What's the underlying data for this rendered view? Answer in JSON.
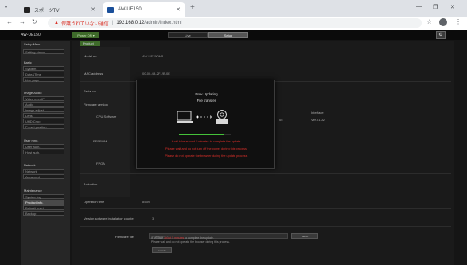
{
  "browser": {
    "tabs": [
      {
        "label": "スポーツTV",
        "active": false
      },
      {
        "label": "AW-UE150",
        "active": true
      }
    ],
    "insecure_label": "保護されていない通信",
    "url_host": "192.168.0.12",
    "url_path": "/admin/index.html"
  },
  "app": {
    "model": "AW-UE150",
    "power_label": "Power ON ▾",
    "view_tabs": {
      "live": "Live",
      "setup": "Setup"
    }
  },
  "sidebar": {
    "groups": [
      {
        "head": "Setup Menu",
        "items": [
          {
            "label": "Setting status"
          }
        ]
      },
      {
        "head": "Basic",
        "items": [
          {
            "label": "System"
          },
          {
            "label": "Date&Time"
          },
          {
            "label": "Live page"
          }
        ]
      },
      {
        "head": "Image/Audio",
        "items": [
          {
            "label": "Video over IP"
          },
          {
            "label": "Audio"
          },
          {
            "label": "Image adjust"
          },
          {
            "label": "Lens"
          },
          {
            "label": "UHD Crop"
          },
          {
            "label": "Preset position"
          }
        ]
      },
      {
        "head": "User mng.",
        "items": [
          {
            "label": "User auth."
          },
          {
            "label": "Host auth."
          }
        ]
      },
      {
        "head": "Network",
        "items": [
          {
            "label": "Network"
          },
          {
            "label": "Advanced"
          }
        ]
      },
      {
        "head": "Maintenance",
        "items": [
          {
            "label": "System log"
          },
          {
            "label": "Product info."
          },
          {
            "label": "Default reset"
          },
          {
            "label": "Backup"
          }
        ]
      }
    ]
  },
  "main": {
    "title": "Product info.",
    "rows": {
      "model_label": "Model no.",
      "model_value": "AW-UE150WP",
      "mac_label": "MAC address",
      "mac_value": "00-00-4B-2F-2B-0E",
      "serial_label": "Serial no.",
      "firmware_label": "Firmware version",
      "cpu_label": "CPU Software",
      "eeprom_label": "EEPROM",
      "fpga_label": "FPGA",
      "activation_label": "Activation",
      "optime_label": "Operation time",
      "optime_value": "855h",
      "install_label": "Version software installation counter",
      "install_value": "3"
    },
    "version_headers": {
      "interface": "Interface"
    },
    "version_values": {
      "cpu_tail": "05",
      "cpu_interface": "Ver.01.02"
    },
    "firmware_file_label": "Firmware file",
    "firmware_input_placeholder": "C:\\fakepath\\...\\...",
    "select_button": "Select",
    "execute_button": "Execute",
    "note_line1_pre": "It will take",
    "note_line1_red": "about 5 minutes",
    "note_line1_post": "to complete the update.",
    "note_line2": "Please wait and do not operate the browser during this process."
  },
  "dialog": {
    "title": "Now Updating",
    "subtitle": "File transfer",
    "progress_fraction": 0.86,
    "messages": [
      "It will take around 5 minutes to complete the update.",
      "Please wait and do not turn off the power during this process.",
      "Please do not operate the browser during the update process."
    ]
  },
  "colors": {
    "accent_green": "#3e6b2a",
    "progress_green": "#45c23a",
    "warning_red": "#e0302a"
  }
}
